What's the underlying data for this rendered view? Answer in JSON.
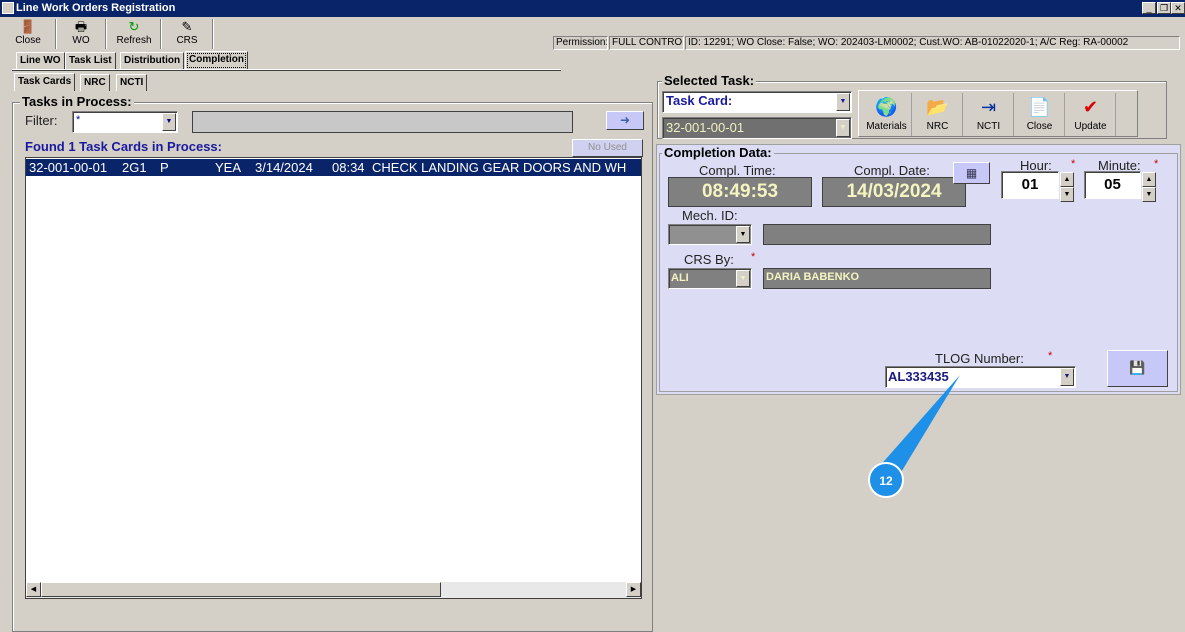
{
  "window": {
    "title": "Line Work Orders Registration",
    "min": "_",
    "max": "❐",
    "close": "✕"
  },
  "toolbar": [
    {
      "label": "Close",
      "icon": "door-exit-icon"
    },
    {
      "label": "WO",
      "icon": "printer-icon"
    },
    {
      "label": "Refresh",
      "icon": "refresh-icon"
    },
    {
      "label": "CRS",
      "icon": "crs-edit-icon"
    }
  ],
  "status": {
    "permission_label": "Permission:",
    "permission_value": "FULL CONTROL",
    "info": "ID: 12291; WO Close: False; WO: 202403-LM0002; Cust.WO: AB-01022020-1; A/C Reg: RA-00002"
  },
  "tabs": [
    "Line WO",
    "Task List",
    "Distribution",
    "Completion"
  ],
  "subtabs": [
    "Task Cards",
    "NRC",
    "NCTI"
  ],
  "tasks": {
    "group_title": "Tasks in Process:",
    "filter_label": "Filter:",
    "filter_value": "*",
    "found_text": "Found 1 Task Cards in Process:",
    "no_used": "No Used",
    "rows": [
      {
        "card": "32-001-00-01",
        "zone": "2G1",
        "type": "P",
        "f": "YEA",
        "date": "3/14/2024",
        "time": "08:34",
        "desc": "CHECK LANDING GEAR DOORS AND WH"
      }
    ]
  },
  "selected_task": {
    "title": "Selected Task:",
    "type_value": "Task Card:",
    "card_value": "32-001-00-01",
    "buttons": [
      {
        "label": "Materials",
        "icon": "globe-hand-icon"
      },
      {
        "label": "NRC",
        "icon": "folder-doc-icon"
      },
      {
        "label": "NCTI",
        "icon": "import-icon"
      },
      {
        "label": "Close",
        "icon": "close-doc-icon"
      },
      {
        "label": "Update",
        "icon": "checklist-icon"
      }
    ]
  },
  "completion": {
    "title": "Completion Data:",
    "time_label": "Compl. Time:",
    "time_value": "08:49:53",
    "date_label": "Compl. Date:",
    "date_value": "14/03/2024",
    "hour_label": "Hour:",
    "hour_value": "01",
    "minute_label": "Minute:",
    "minute_value": "05",
    "mech_label": "Mech. ID:",
    "crs_label": "CRS By:",
    "crs_value": "ALI",
    "crs_name": "DARIA BABENKO",
    "tlog_label": "TLOG Number:",
    "tlog_value": "AL333435",
    "req": "*"
  },
  "callout": {
    "number": "12",
    "color": "#1e90e8"
  }
}
